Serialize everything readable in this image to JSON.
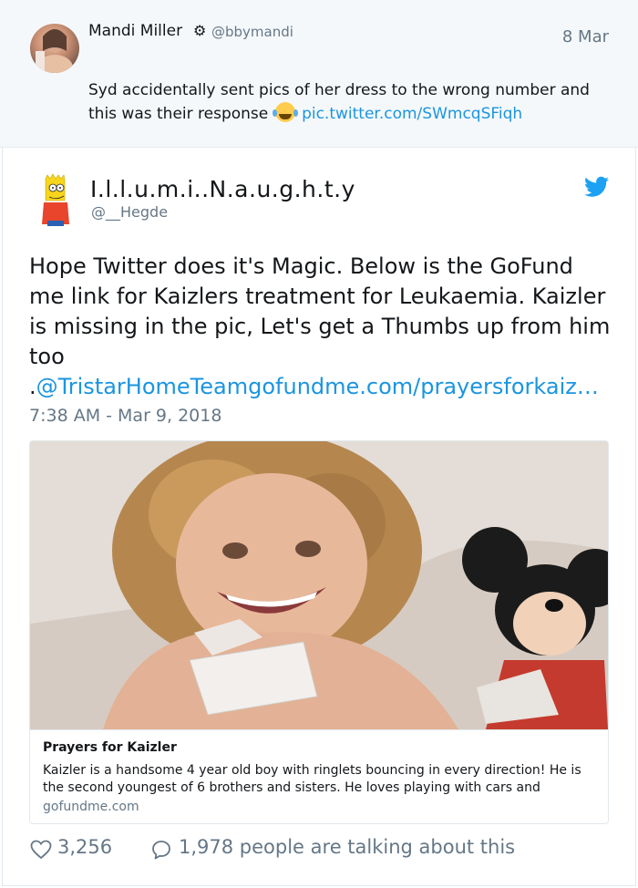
{
  "quoted_tweet": {
    "name": "Mandi Miller",
    "verified_icon": "gear-icon",
    "handle": "@bbymandi",
    "date": "8 Mar",
    "text_before": "Syd accidentally sent pics of her dress to the wrong number and this was their response",
    "emoji": "laughing-tears-emoji",
    "link": "pic.twitter.com/SWmcqSFiqh"
  },
  "tweet": {
    "name": "I.l.l.u.m.i..N.a.u.g.h.t.y",
    "handle": "@__Hegde",
    "platform_icon": "twitter-bird-icon",
    "text": "Hope Twitter does it's Magic. Below is the GoFund me link for Kaizlers treatment for Leukaemia. Kaizler is missing in the pic, Let's get a Thumbs up from him too",
    "text_dot": ".",
    "mention_link": "@TristarHomeTeam",
    "url_link": "gofundme.com/prayersforkaiz…",
    "timestamp": "7:38 AM - Mar 9, 2018",
    "card": {
      "title": "Prayers for Kaizler",
      "description": "Kaizler is a handsome 4 year old boy with ringlets bouncing in every direction! He is the second youngest of 6 brothers and sisters. He loves playing with cars and",
      "domain": "gofundme.com"
    },
    "likes": "3,256",
    "talking": "1,978 people are talking about this"
  },
  "colors": {
    "link": "#1b95e0",
    "muted": "#657786",
    "quoted_bg": "#f5f8fa"
  }
}
